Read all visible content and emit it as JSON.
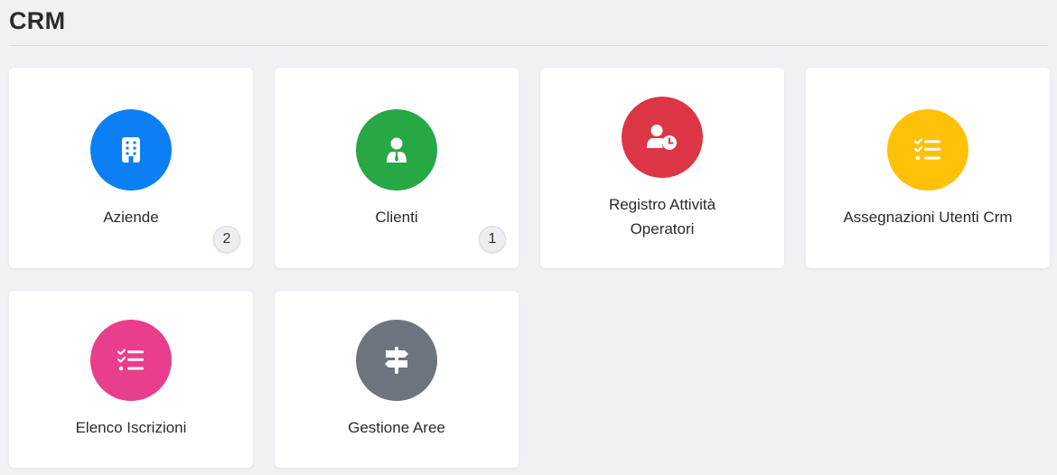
{
  "header": {
    "title": "CRM"
  },
  "cards": [
    {
      "label": "Aziende",
      "icon": "building-icon",
      "color": "#0d7ff5",
      "badge": "2"
    },
    {
      "label": "Clienti",
      "icon": "user-tie-icon",
      "color": "#28a745",
      "badge": "1"
    },
    {
      "label_lines": [
        "Registro Attività",
        "Operatori"
      ],
      "icon": "user-clock-icon",
      "color": "#dc3545"
    },
    {
      "label": "Assegnazioni Utenti Crm",
      "icon": "list-check-icon",
      "color": "#ffc107"
    },
    {
      "label": "Elenco Iscrizioni",
      "icon": "list-check-icon",
      "color": "#e83e8c"
    },
    {
      "label": "Gestione Aree",
      "icon": "signs-post-icon",
      "color": "#6c757d"
    }
  ]
}
